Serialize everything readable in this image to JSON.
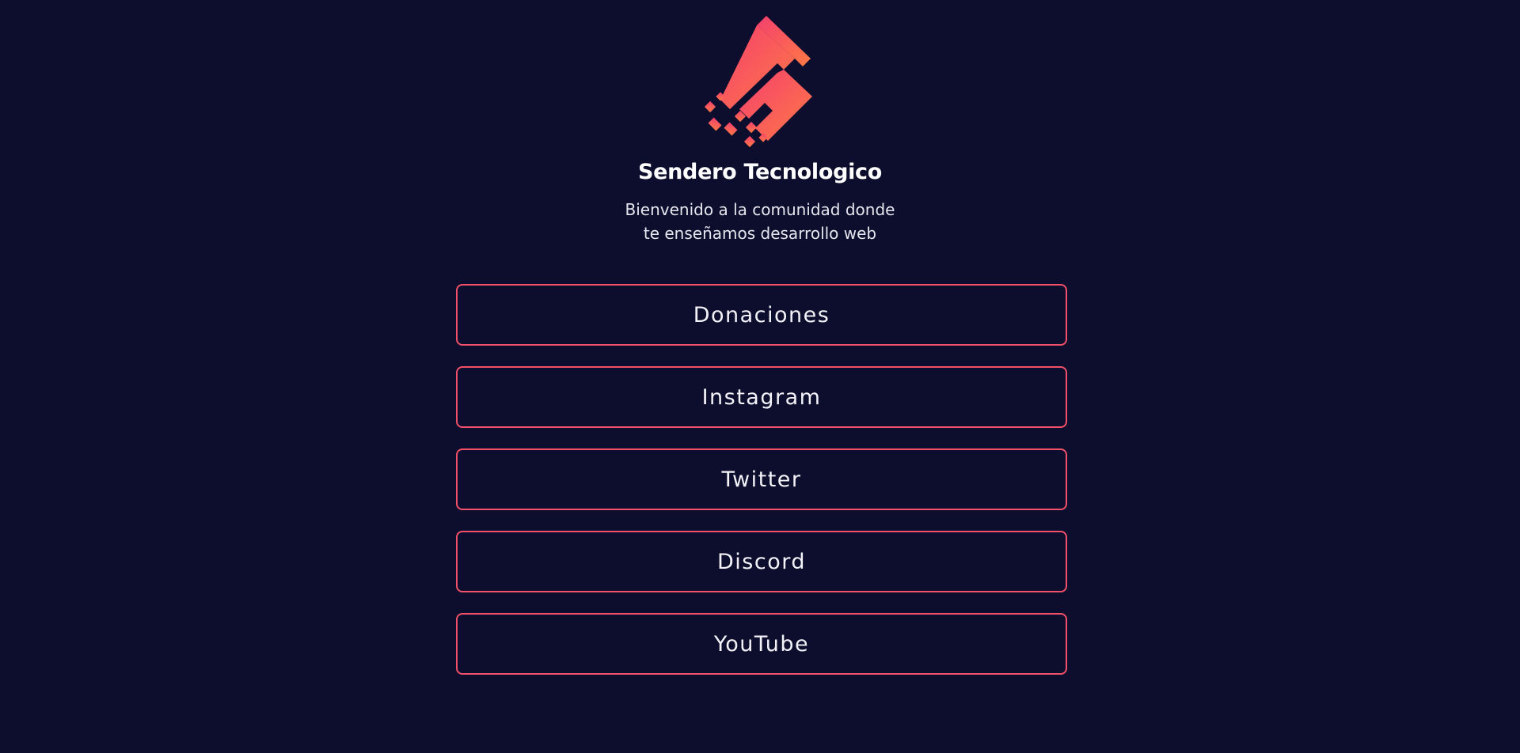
{
  "brand": {
    "name": "Sendero Tecnologico",
    "logo_icon": "sendero-rocket-logo-icon",
    "accent_start": "#f43f6e",
    "accent_end": "#ff7a45"
  },
  "welcome": {
    "line1": "Bienvenido a la comunidad donde",
    "line2": "te enseñamos desarrollo web"
  },
  "links": [
    {
      "label": "Donaciones"
    },
    {
      "label": "Instagram"
    },
    {
      "label": "Twitter"
    },
    {
      "label": "Discord"
    },
    {
      "label": "YouTube"
    }
  ],
  "colors": {
    "background": "#0d0d2d",
    "button_border": "#f0506a"
  }
}
